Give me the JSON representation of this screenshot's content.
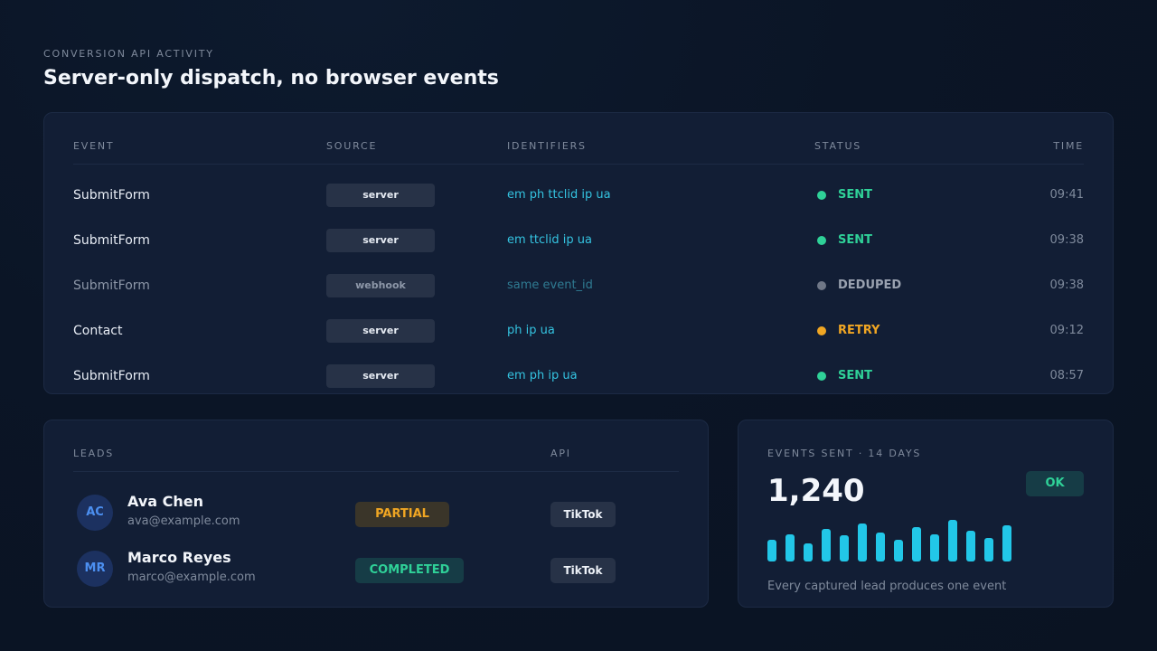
{
  "header": {
    "kicker": "CONVERSION API ACTIVITY",
    "title": "Server-only dispatch, no browser events"
  },
  "events_table": {
    "columns": [
      "EVENT",
      "SOURCE",
      "IDENTIFIERS",
      "STATUS",
      "TIME"
    ],
    "rows": [
      {
        "event": "SubmitForm",
        "source": "server",
        "identifiers": "em ph ttclid ip ua",
        "status": "SENT",
        "time": "09:41",
        "muted": false,
        "status_color": "#2fd198"
      },
      {
        "event": "SubmitForm",
        "source": "server",
        "identifiers": "em ttclid ip ua",
        "status": "SENT",
        "time": "09:38",
        "muted": false,
        "status_color": "#2fd198"
      },
      {
        "event": "SubmitForm",
        "source": "webhook",
        "identifiers": "same event_id",
        "status": "DEDUPED",
        "time": "09:38",
        "muted": true,
        "status_color": "#6f7787"
      },
      {
        "event": "Contact",
        "source": "server",
        "identifiers": "ph ip ua",
        "status": "RETRY",
        "time": "09:12",
        "muted": false,
        "status_color": "#f0a623"
      },
      {
        "event": "SubmitForm",
        "source": "server",
        "identifiers": "em ph ip ua",
        "status": "SENT",
        "time": "08:57",
        "muted": false,
        "status_color": "#2fd198"
      }
    ]
  },
  "leads": {
    "heading": "LEADS",
    "api_heading": "API",
    "items": [
      {
        "initials": "AC",
        "name": "Ava Chen",
        "email": "ava@example.com",
        "state": "PARTIAL",
        "api": "TikTok"
      },
      {
        "initials": "MR",
        "name": "Marco Reyes",
        "email": "marco@example.com",
        "state": "COMPLETED",
        "api": "TikTok"
      }
    ]
  },
  "stats": {
    "heading": "EVENTS SENT · 14 DAYS",
    "total": "1,240",
    "badge": "OK",
    "caption": "Every captured lead produces one event",
    "daily_relative": [
      0.5,
      0.62,
      0.42,
      0.75,
      0.6,
      0.88,
      0.66,
      0.5,
      0.8,
      0.62,
      0.96,
      0.7,
      0.55,
      0.84
    ],
    "accent": "#22c7e8"
  }
}
